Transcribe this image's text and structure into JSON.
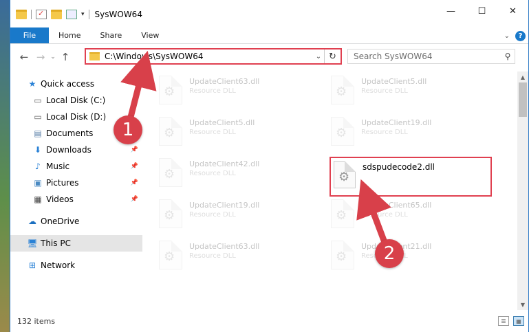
{
  "window": {
    "title": "SysWOW64"
  },
  "ribbon": {
    "tabs": [
      "File",
      "Home",
      "Share",
      "View"
    ]
  },
  "nav": {
    "address": "C:\\Windows\\SysWOW64",
    "search_placeholder": "Search SysWOW64"
  },
  "sidebar": {
    "items": [
      {
        "label": "Quick access",
        "icon": "star-icon",
        "pinned": false
      },
      {
        "label": "Local Disk (C:)",
        "icon": "drive-icon",
        "pinned": false
      },
      {
        "label": "Local Disk (D:)",
        "icon": "drive-icon",
        "pinned": false
      },
      {
        "label": "Documents",
        "icon": "documents-icon",
        "pinned": true
      },
      {
        "label": "Downloads",
        "icon": "download-icon",
        "pinned": true
      },
      {
        "label": "Music",
        "icon": "music-icon",
        "pinned": true
      },
      {
        "label": "Pictures",
        "icon": "pictures-icon",
        "pinned": true
      },
      {
        "label": "Videos",
        "icon": "videos-icon",
        "pinned": true
      },
      {
        "label": "OneDrive",
        "icon": "cloud-icon",
        "pinned": false
      },
      {
        "label": "This PC",
        "icon": "computer-icon",
        "pinned": false,
        "selected": true
      },
      {
        "label": "Network",
        "icon": "network-icon",
        "pinned": false
      }
    ]
  },
  "files": [
    {
      "name": "UpdateClient63.dll",
      "desc": "Resource DLL"
    },
    {
      "name": "UpdateClient5.dll",
      "desc": "Resource DLL"
    },
    {
      "name": "UpdateClient5.dll",
      "desc": "Resource DLL"
    },
    {
      "name": "UpdateClient19.dll",
      "desc": "Resource DLL"
    },
    {
      "name": "UpdateClient42.dll",
      "desc": "Resource DLL"
    },
    {
      "name": "sdspudecode2.dll",
      "desc": ""
    },
    {
      "name": "UpdateClient19.dll",
      "desc": "Resource DLL"
    },
    {
      "name": "UpdateClient65.dll",
      "desc": "Resource DLL"
    },
    {
      "name": "UpdateClient63.dll",
      "desc": "Resource DLL"
    },
    {
      "name": "UpdateClient21.dll",
      "desc": "Resource DLL"
    }
  ],
  "status": {
    "items_count": "132 items"
  },
  "annotations": {
    "step1": "1",
    "step2": "2"
  },
  "colors": {
    "accent": "#1979ca",
    "highlight": "#e04050",
    "badge": "#d8404a"
  }
}
